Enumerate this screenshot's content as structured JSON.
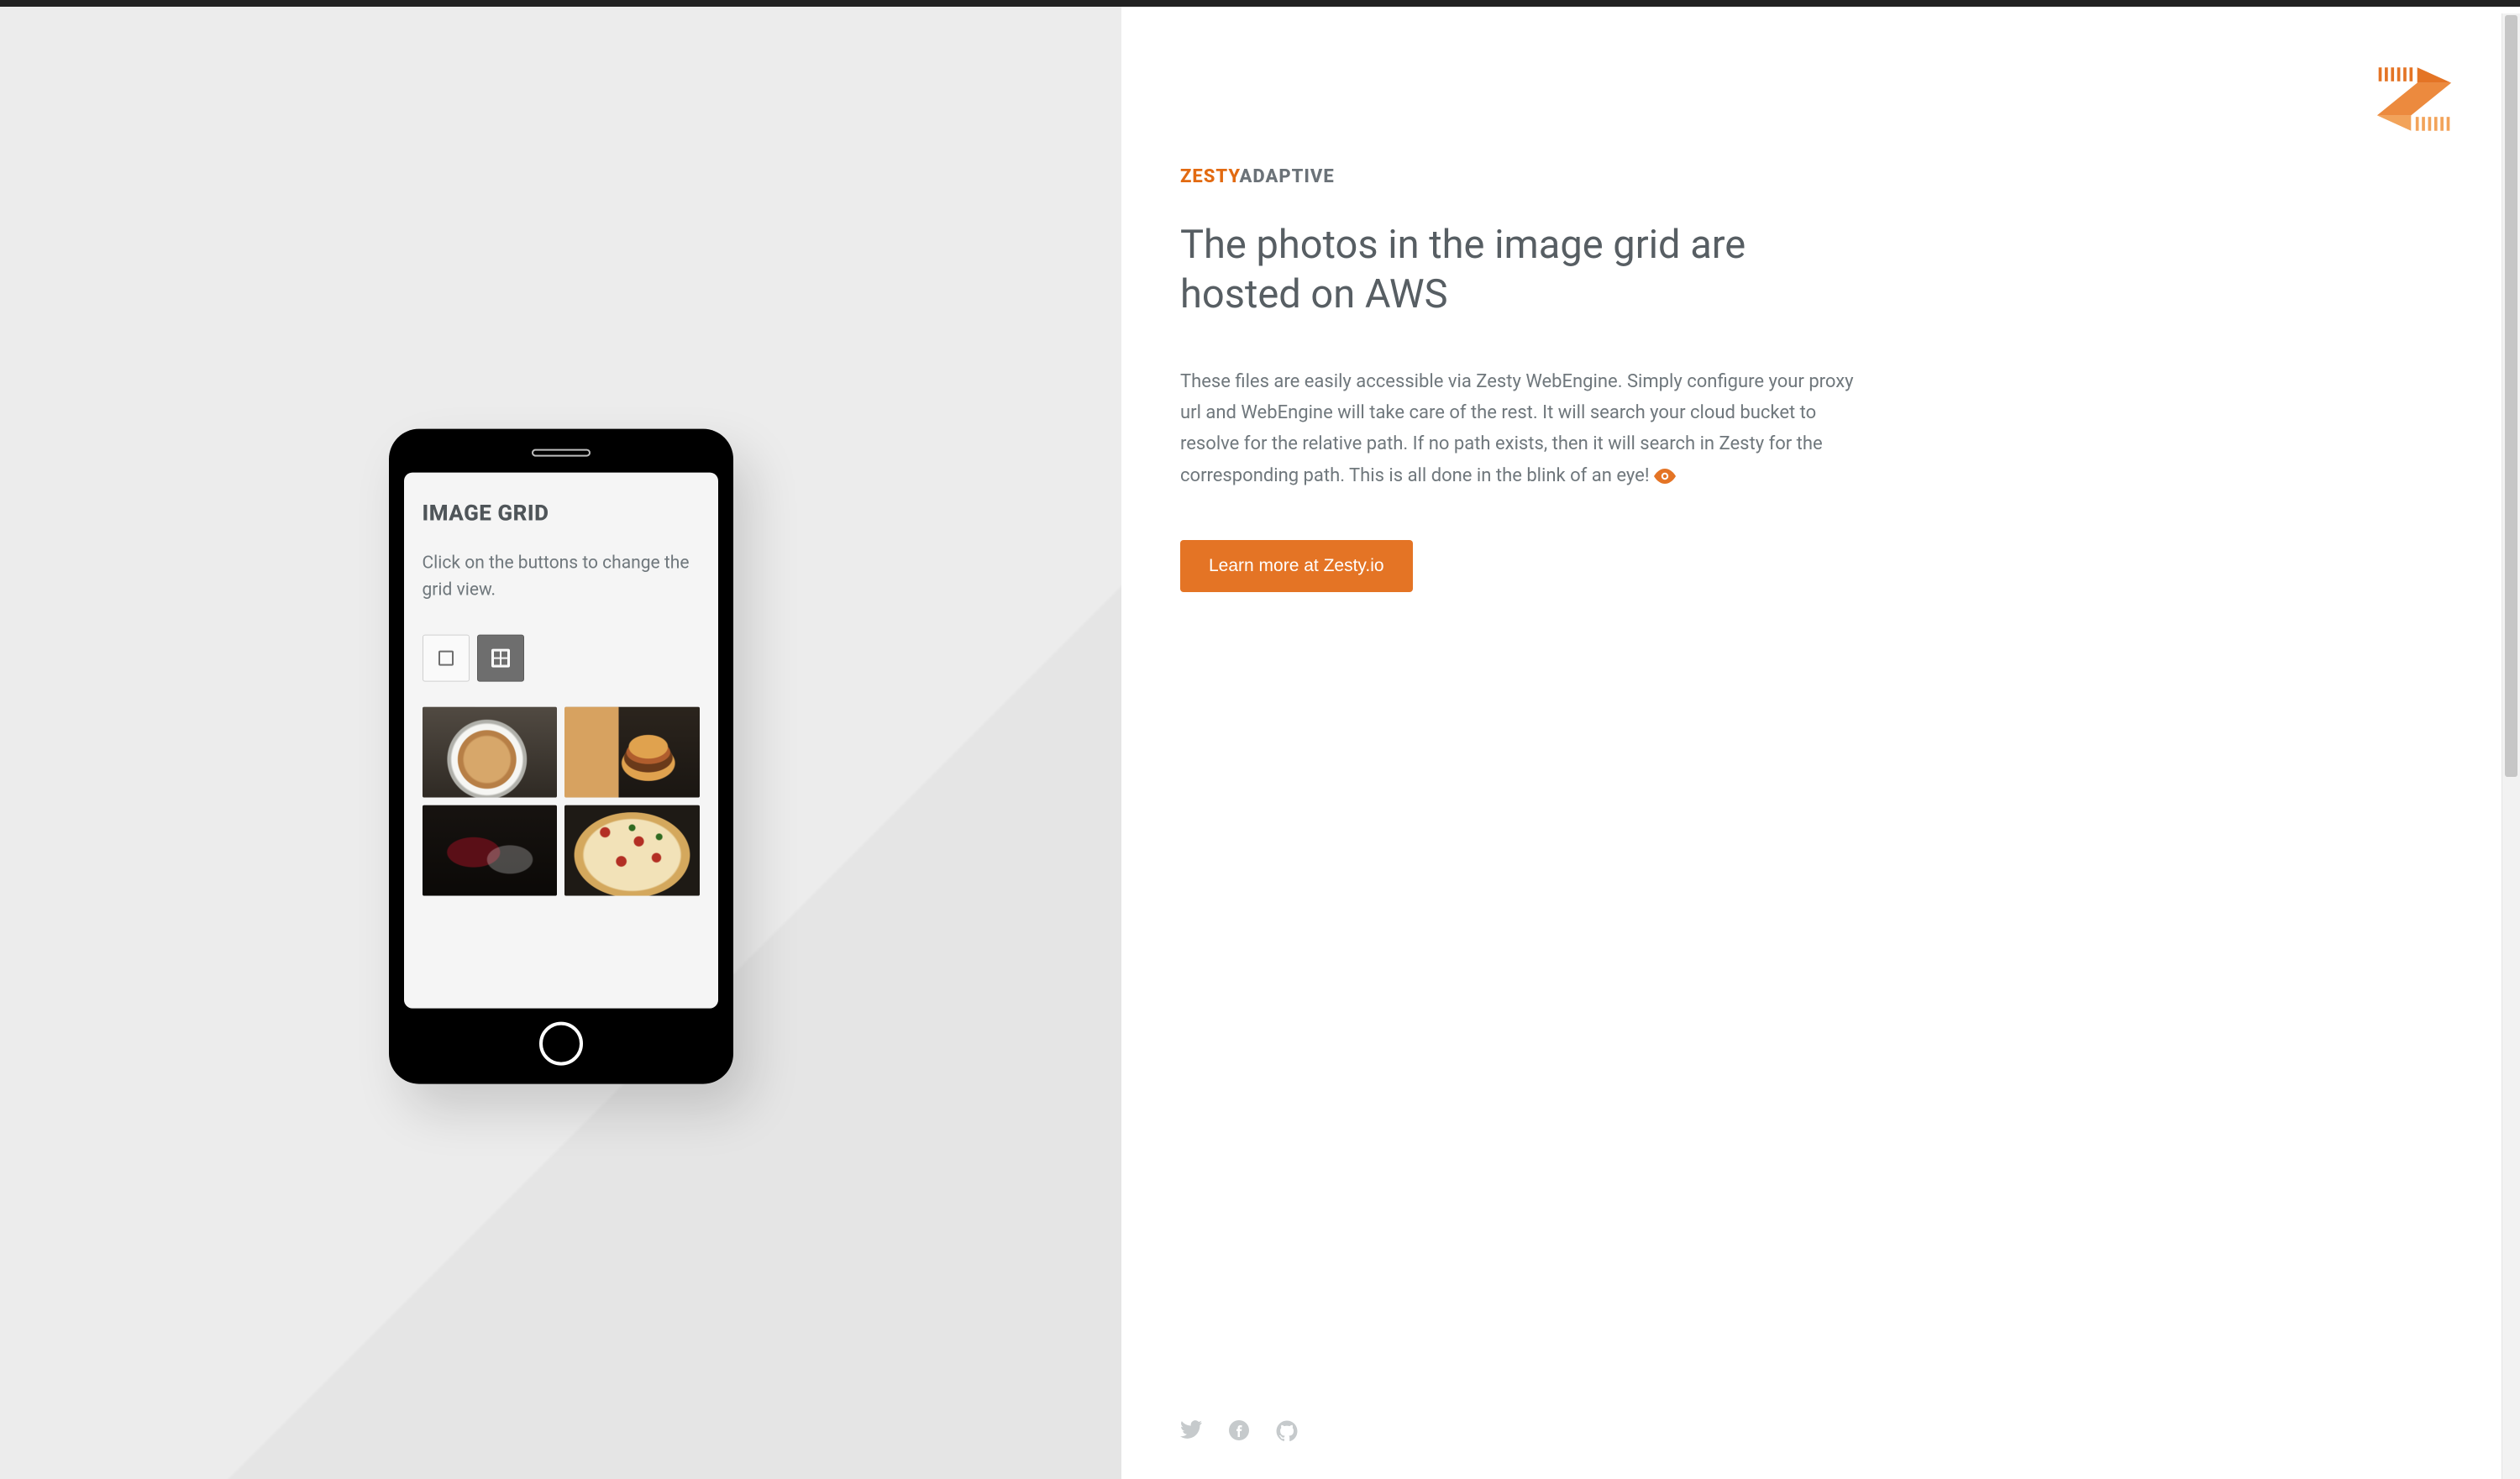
{
  "phone": {
    "title": "IMAGE GRID",
    "subtitle": "Click on the buttons to change the grid view.",
    "views": {
      "single_icon": "single-view-icon",
      "grid_icon": "grid-view-icon",
      "active": "grid"
    },
    "images": [
      "coffee",
      "burger",
      "wine",
      "pizza"
    ]
  },
  "brand": {
    "part1": "ZESTY",
    "part2": "ADAPTIVE",
    "logo_icon": "zesty-logo"
  },
  "content": {
    "headline": "The photos in the image grid are hosted on AWS",
    "body": "These files are easily accessible via Zesty WebEngine. Simply configure your proxy url and WebEngine will take care of the rest. It will search your cloud bucket to resolve for the relative path. If no path exists, then it will search in Zesty for the corresponding path. This is all done in the blink of an eye! ",
    "eye_icon": "eye-icon",
    "cta": "Learn more at Zesty.io"
  },
  "social": {
    "twitter": "twitter-icon",
    "facebook": "facebook-icon",
    "github": "github-icon"
  },
  "colors": {
    "accent": "#e47425",
    "brand_orange": "#e26a11",
    "text_gray": "#6f777c"
  }
}
